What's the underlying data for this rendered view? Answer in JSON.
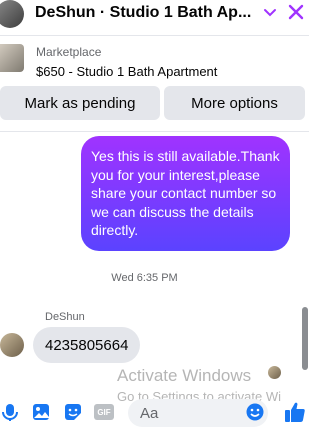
{
  "header": {
    "title": "DeShun · Studio 1 Bath Ap...",
    "chevron_icon": "chevron-down-icon",
    "close_icon": "close-icon",
    "accent": "#a033ff"
  },
  "marketplace": {
    "label": "Marketplace",
    "listing": "$650 - Studio 1 Bath Apartment"
  },
  "actions": {
    "pending_label": "Mark as pending",
    "more_label": "More options"
  },
  "messages": {
    "outgoing_text": "Yes this is still available.Thank you for your interest,please share your contact number so we can discuss the details directly.",
    "timestamp": "Wed 6:35 PM",
    "sender_name": "DeShun",
    "incoming_text": "4235805664"
  },
  "watermark": {
    "line1": "Activate Windows",
    "line2": "Go to Settings to activate Wi"
  },
  "composer": {
    "placeholder": "Aa",
    "icons": [
      "mic-icon",
      "photo-icon",
      "sticker-icon",
      "gif-icon",
      "emoji-icon",
      "thumbs-up-icon"
    ],
    "gif_label": "GIF"
  }
}
